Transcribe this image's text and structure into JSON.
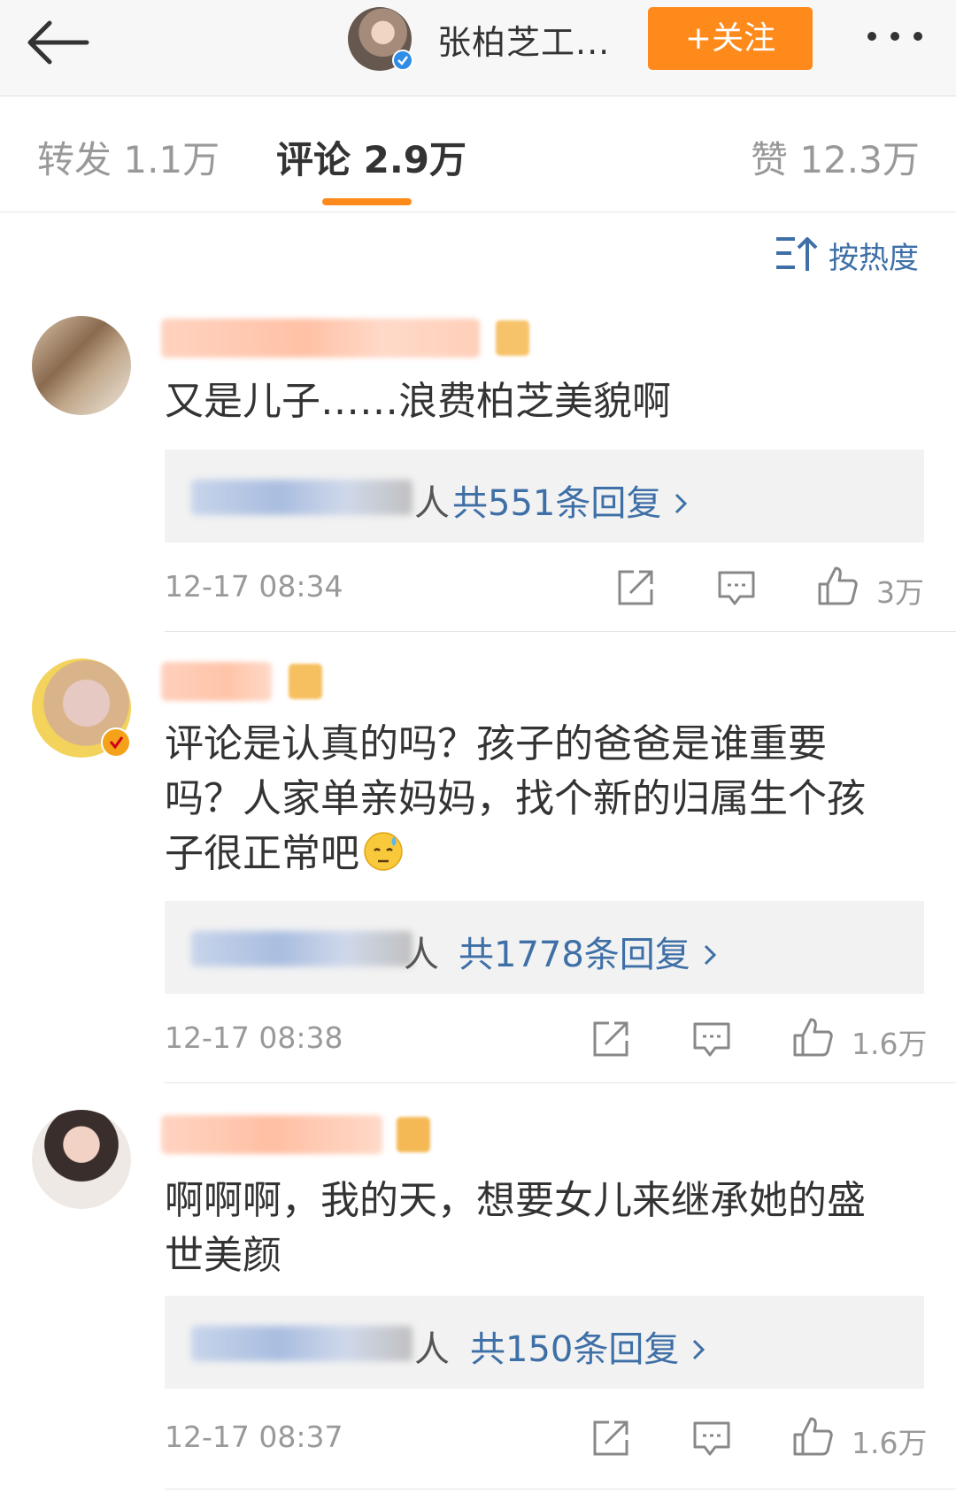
{
  "header": {
    "account_name": "张柏芝工...",
    "follow_label": "+关注"
  },
  "tabs": {
    "reposts": "转发 1.1万",
    "comments": "评论 2.9万",
    "likes": "赞 12.3万"
  },
  "sort": {
    "label": "按热度"
  },
  "comments": [
    {
      "text": "又是儿子……浪费柏芝美貌啊",
      "reply_suffix": "人",
      "reply_count": "共551条回复",
      "time": "12-17 08:34",
      "likes": "3万"
    },
    {
      "text": "评论是认真的吗？孩子的爸爸是谁重要吗？人家单亲妈妈，找个新的归属生个孩子很正常吧",
      "reply_suffix": "人",
      "reply_count": "共1778条回复",
      "time": "12-17 08:38",
      "likes": "1.6万"
    },
    {
      "text": "啊啊啊，我的天，想要女儿来继承她的盛世美颜",
      "reply_suffix": "人",
      "reply_count": "共150条回复",
      "time": "12-17 08:37",
      "likes": "1.6万"
    }
  ],
  "colors": {
    "accent_orange": "#ff8a1c",
    "link_blue": "#3e6fa6",
    "verified_blue": "#2f8de8"
  }
}
